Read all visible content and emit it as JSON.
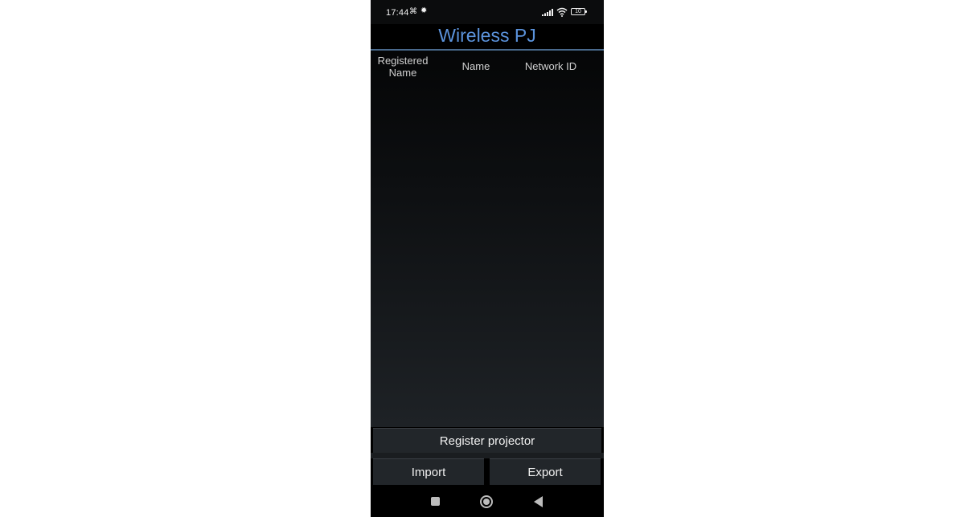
{
  "status_bar": {
    "time": "17:44",
    "battery": "10",
    "icons": [
      "notification-icon",
      "bug-icon",
      "signal-icon",
      "wifi-icon",
      "battery-icon"
    ]
  },
  "app": {
    "title": "Wireless PJ",
    "title_color": "#5b93dc"
  },
  "table": {
    "columns": [
      "Registered\nName",
      "Name",
      "Network ID"
    ],
    "rows": []
  },
  "buttons": {
    "register": "Register projector",
    "import": "Import",
    "export": "Export"
  },
  "nav_bar": {
    "icons": [
      "recent-apps-icon",
      "home-icon",
      "back-icon"
    ]
  }
}
